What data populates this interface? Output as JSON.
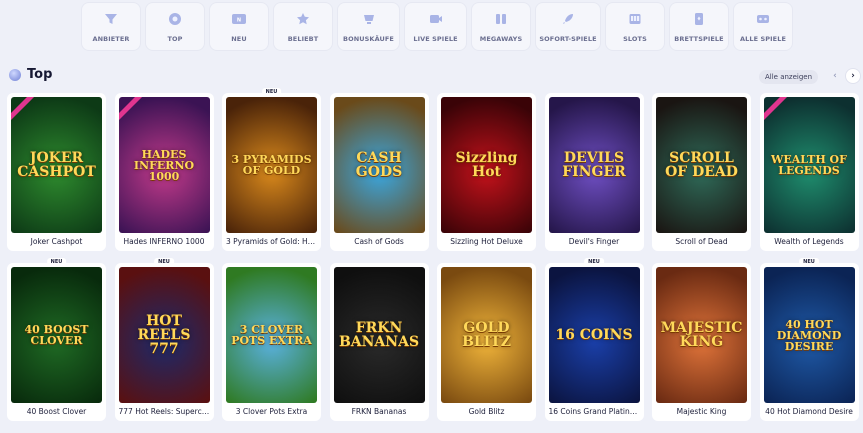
{
  "categories": [
    {
      "label": "ANBIETER",
      "icon": "funnel-icon"
    },
    {
      "label": "TOP",
      "icon": "gear-badge-icon"
    },
    {
      "label": "NEU",
      "icon": "new-badge-icon"
    },
    {
      "label": "BELIEBT",
      "icon": "star-icon"
    },
    {
      "label": "BONUSKÄUFE",
      "icon": "bonus-cup-icon"
    },
    {
      "label": "LIVE SPIELE",
      "icon": "video-camera-icon"
    },
    {
      "label": "MEGAWAYS",
      "icon": "megaways-icon"
    },
    {
      "label": "SOFORT-SPIELE",
      "icon": "rocket-icon"
    },
    {
      "label": "SLOTS",
      "icon": "slot-machine-icon"
    },
    {
      "label": "BRETTSPIELE",
      "icon": "playing-card-icon"
    },
    {
      "label": "ALLE SPIELE",
      "icon": "all-games-icon"
    }
  ],
  "section": {
    "title": "Top",
    "see_all": "Alle anzeigen"
  },
  "games": [
    {
      "name": "Joker Cashpot",
      "art": "JOKER CASHPOT",
      "badge": "",
      "ribbon": true,
      "bg": "#2e8b2e",
      "bg2": "#0d3a16"
    },
    {
      "name": "Hades INFERNO 1000",
      "art": "HADES INFERNO 1000",
      "badge": "",
      "ribbon": true,
      "bg": "#c23a8a",
      "bg2": "#3b1354"
    },
    {
      "name": "3 Pyramids of Gold: Hol…",
      "art": "3 PYRAMIDS OF GOLD",
      "badge": "NEU",
      "ribbon": false,
      "bg": "#d9891c",
      "bg2": "#4a2309"
    },
    {
      "name": "Cash of Gods",
      "art": "CASH GODS",
      "badge": "",
      "ribbon": false,
      "bg": "#3aa7e0",
      "bg2": "#6a4a1a"
    },
    {
      "name": "Sizzling Hot Deluxe",
      "art": "Sizzling Hot",
      "badge": "",
      "ribbon": false,
      "bg": "#c3121b",
      "bg2": "#3a0307"
    },
    {
      "name": "Devil's Finger",
      "art": "DEVILS FINGER",
      "badge": "",
      "ribbon": false,
      "bg": "#6f4fc3",
      "bg2": "#25164a"
    },
    {
      "name": "Scroll of Dead",
      "art": "SCROLL OF DEAD",
      "badge": "",
      "ribbon": false,
      "bg": "#2f6b59",
      "bg2": "#1a1512"
    },
    {
      "name": "Wealth of Legends",
      "art": "WEALTH OF LEGENDS",
      "badge": "",
      "ribbon": true,
      "bg": "#1f8e6e",
      "bg2": "#0d3030"
    },
    {
      "name": "40 Boost Clover",
      "art": "40 BOOST CLOVER",
      "badge": "NEU",
      "ribbon": false,
      "bg": "#1f6a24",
      "bg2": "#082a0c"
    },
    {
      "name": "777 Hot Reels: Superch…",
      "art": "HOT REELS 777",
      "badge": "NEU",
      "ribbon": false,
      "bg": "#1c2a6b",
      "bg2": "#5a1010"
    },
    {
      "name": "3 Clover Pots Extra",
      "art": "3 CLOVER POTS EXTRA",
      "badge": "",
      "ribbon": false,
      "bg": "#5ab1e0",
      "bg2": "#2f7a22"
    },
    {
      "name": "FRKN Bananas",
      "art": "FRKN BANANAS",
      "badge": "",
      "ribbon": false,
      "bg": "#2a2a2a",
      "bg2": "#0f0f0f"
    },
    {
      "name": "Gold Blitz",
      "art": "GOLD BLITZ",
      "badge": "",
      "ribbon": false,
      "bg": "#f0b43a",
      "bg2": "#7a4a10"
    },
    {
      "name": "16 Coins Grand Platinu…",
      "art": "16 COINS",
      "badge": "NEU",
      "ribbon": false,
      "bg": "#1a3fa8",
      "bg2": "#0b1440"
    },
    {
      "name": "Majestic King",
      "art": "MAJESTIC KING",
      "badge": "",
      "ribbon": false,
      "bg": "#e0743a",
      "bg2": "#6a2a12"
    },
    {
      "name": "40 Hot Diamond Desire",
      "art": "40 HOT DIAMOND DESIRE",
      "badge": "NEU",
      "ribbon": false,
      "bg": "#1f5aa8",
      "bg2": "#0b2455"
    }
  ]
}
